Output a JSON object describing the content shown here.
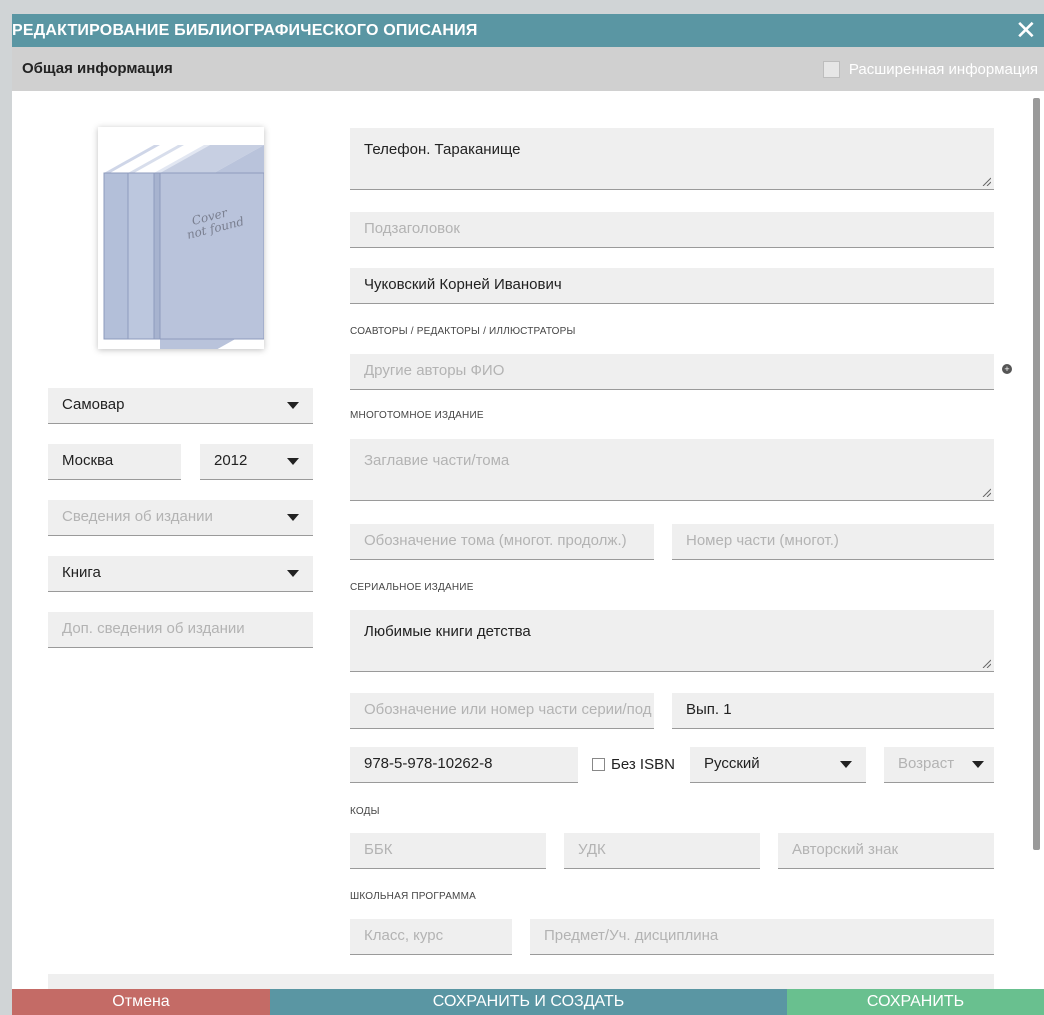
{
  "dialog": {
    "title": "РЕДАКТИРОВАНИЕ БИБЛИОГРАФИЧЕСКОГО ОПИСАНИЯ",
    "close_glyph": "✕",
    "tab_general": "Общая информация",
    "extended_label": "Расширенная информация",
    "extended_checked": false
  },
  "cover": {
    "line1": "Cover",
    "line2": "not found",
    "icon": "book-stack-placeholder"
  },
  "left": {
    "publisher": "Самовар",
    "city": "Москва",
    "year": "2012",
    "edition_placeholder": "Сведения об издании",
    "doc_type": "Книга",
    "extra_placeholder": "Доп. сведения об издании"
  },
  "main": {
    "title_value": "Телефон. Тараканище",
    "subtitle_placeholder": "Подзаголовок",
    "author_value": "Чуковский Корней Иванович",
    "coauthors_section": "СОАВТОРЫ / РЕДАКТОРЫ / ИЛЛЮСТРАТОРЫ",
    "coauthors_placeholder": "Другие авторы ФИО",
    "add_glyph": "+",
    "multivolume_section": "МНОГОТОМНОЕ ИЗДАНИЕ",
    "volume_title_placeholder": "Заглавие части/тома",
    "volume_designation_placeholder": "Обозначение тома (многот. продолж.)",
    "part_number_placeholder": "Номер части (многот.)",
    "serial_section": "СЕРИАЛЬНОЕ ИЗДАНИЕ",
    "series_value": "Любимые книги детства",
    "series_part_placeholder": "Обозначение или номер части серии/под",
    "issue_value": "Вып. 1",
    "isbn_value": "978-5-978-10262-8",
    "no_isbn_label": "Без ISBN",
    "no_isbn_checked": false,
    "language": "Русский",
    "age_placeholder": "Возраст",
    "codes_section": "КОДЫ",
    "bbk_placeholder": "ББК",
    "udk_placeholder": "УДК",
    "author_mark_placeholder": "Авторский знак",
    "school_section": "ШКОЛЬНАЯ ПРОГРАММА",
    "class_placeholder": "Класс, курс",
    "subject_placeholder": "Предмет/Уч. дисциплина"
  },
  "footer": {
    "cancel": "Отмена",
    "save_create": "СОХРАНИТЬ И СОЗДАТЬ",
    "save": "СОХРАНИТЬ"
  },
  "colors": {
    "header": "#5a96a3",
    "cancel": "#c46b66",
    "save_create": "#5a96a3",
    "save": "#69c08f",
    "input_bg": "#efefef"
  }
}
